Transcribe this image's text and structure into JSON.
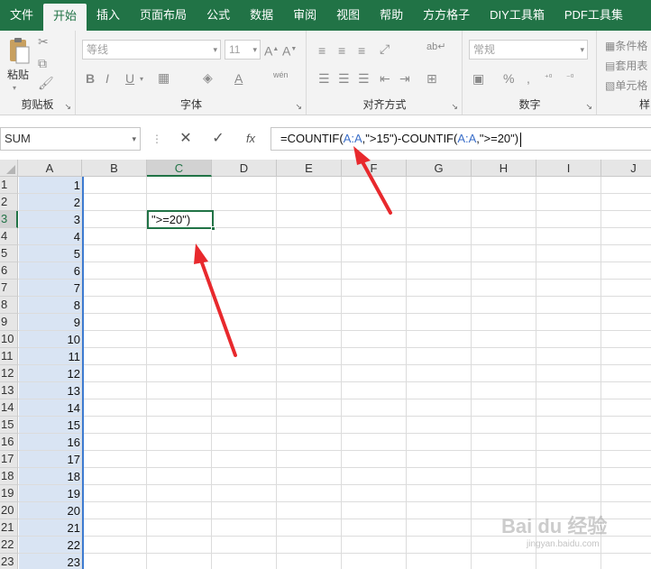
{
  "ribbon": {
    "tabs": [
      {
        "label": "文件",
        "active": false
      },
      {
        "label": "开始",
        "active": true
      },
      {
        "label": "插入",
        "active": false
      },
      {
        "label": "页面布局",
        "active": false
      },
      {
        "label": "公式",
        "active": false
      },
      {
        "label": "数据",
        "active": false
      },
      {
        "label": "审阅",
        "active": false
      },
      {
        "label": "视图",
        "active": false
      },
      {
        "label": "帮助",
        "active": false
      },
      {
        "label": "方方格子",
        "active": false
      },
      {
        "label": "DIY工具箱",
        "active": false
      },
      {
        "label": "PDF工具集",
        "active": false
      }
    ],
    "clipboard": {
      "paste_label": "粘贴",
      "group_label": "剪贴板"
    },
    "font": {
      "font_name": "等线",
      "font_size": "11",
      "phonetic_label": "wén",
      "group_label": "字体"
    },
    "alignment": {
      "group_label": "对齐方式"
    },
    "number": {
      "format": "常规",
      "group_label": "数字"
    },
    "styles": {
      "items": [
        "条件格",
        "套用表",
        "单元格"
      ],
      "group_label": "样"
    }
  },
  "formula_bar": {
    "name_box": "SUM",
    "formula_parts": [
      "=COUNTIF(",
      "A:A",
      ",\">15\")-COUNTIF(",
      "A:A",
      ",\">=20\")"
    ]
  },
  "sheet": {
    "columns": [
      "A",
      "B",
      "C",
      "D",
      "E",
      "F",
      "G",
      "H",
      "I",
      "J"
    ],
    "selected_column": "C",
    "rows": [
      "1",
      "2",
      "3",
      "4",
      "5",
      "6",
      "7",
      "8",
      "9",
      "10",
      "11",
      "12",
      "13",
      "14",
      "15",
      "16",
      "17",
      "18",
      "19",
      "20",
      "21",
      "22",
      "23"
    ],
    "selected_row": "3",
    "column_a_values": [
      "1",
      "2",
      "3",
      "4",
      "5",
      "6",
      "7",
      "8",
      "9",
      "10",
      "11",
      "12",
      "13",
      "14",
      "15",
      "16",
      "17",
      "18",
      "19",
      "20",
      "21",
      "22",
      "23"
    ],
    "active_cell_text": "\">=20\")"
  },
  "colors": {
    "accent": "#217346",
    "range_highlight": "#3d7bd1",
    "arrow": "#e8292d"
  },
  "watermark": {
    "brand": "Bai du 经验",
    "url": "jingyan.baidu.com"
  }
}
